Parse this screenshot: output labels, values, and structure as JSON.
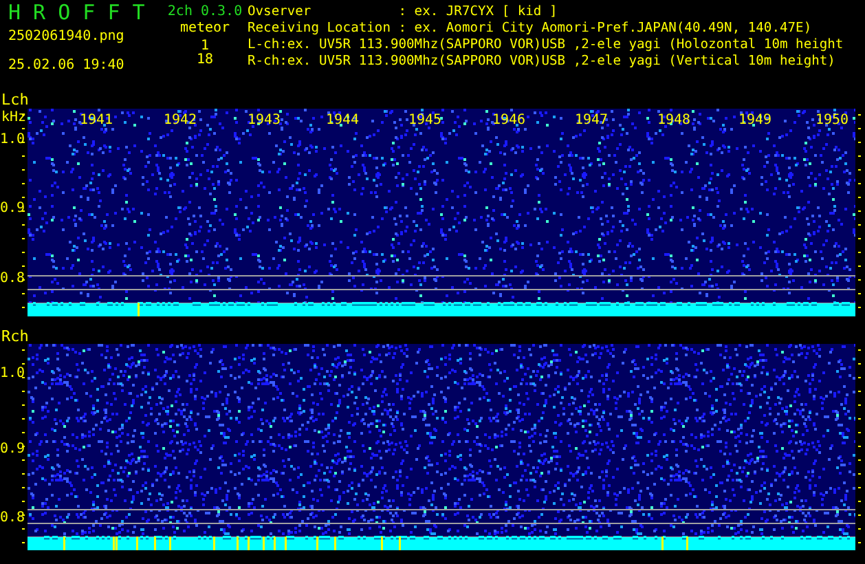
{
  "app": {
    "title": "H R O F F T",
    "version": "2ch 0.3.0",
    "filename": "2502061940.png",
    "timestamp": "25.02.06 19:40",
    "meteor_label": "meteor",
    "meteor_counts": [
      "1",
      "18"
    ]
  },
  "info_lines": [
    "Ovserver           : ex. JR7CYX [ kid ]",
    "Receiving Location : ex. Aomori City Aomori-Pref.JAPAN(40.49N, 140.47E)",
    "L-ch:ex. UV5R 113.900Mhz(SAPPORO VOR)USB ,2-ele yagi (Holozontal 10m height",
    "R-ch:ex. UV5R 113.900Mhz(SAPPORO VOR)USB ,2-ele yagi (Vertical 10m height)"
  ],
  "panels": [
    {
      "channel": "Lch",
      "unit": "kHz",
      "time_labels": [
        "1941",
        "1942",
        "1943",
        "1944",
        "1945",
        "1946",
        "1947",
        "1948",
        "1949",
        "1950"
      ],
      "freq_labels": [
        "1.0",
        "0.9",
        "0.8"
      ]
    },
    {
      "channel": "Rch",
      "freq_labels": [
        "1.0",
        "0.9",
        "0.8"
      ]
    }
  ]
}
